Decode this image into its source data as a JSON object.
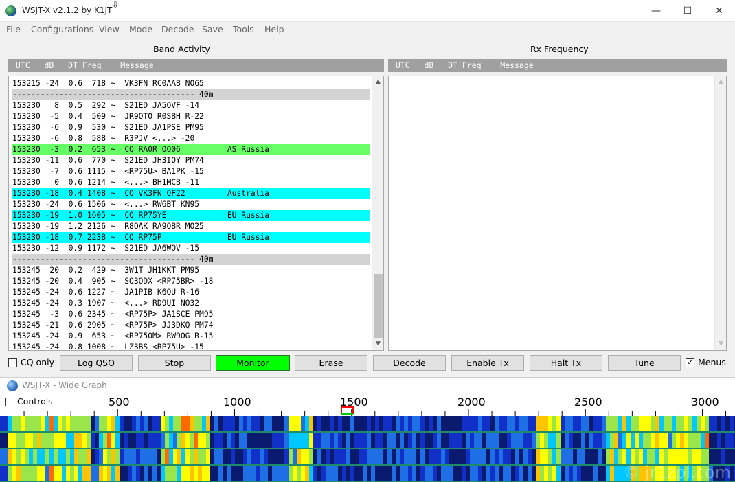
{
  "window": {
    "title": "WSJT-X   v2.1.2   by K1JT",
    "min_glyph": "—",
    "max_glyph": "☐",
    "close_glyph": "✕"
  },
  "menu": [
    "File",
    "Configurations",
    "View",
    "Mode",
    "Decode",
    "Save",
    "Tools",
    "Help"
  ],
  "band_activity": {
    "title": "Band Activity",
    "header": " UTC   dB   DT Freq    Message",
    "rows": [
      {
        "text": "153215 -24  0.6  718 ~  VK3FN RC0AAB NO65",
        "style": ""
      },
      {
        "text": "--------------------------------------- 40m",
        "style": "sep"
      },
      {
        "text": "153230   8  0.5  292 ~  S21ED JA5OVF -14",
        "style": ""
      },
      {
        "text": "153230  -5  0.4  509 ~  JR9OTO R0SBH R-22",
        "style": ""
      },
      {
        "text": "153230  -6  0.9  530 ~  S21ED JA1PSE PM95",
        "style": ""
      },
      {
        "text": "153230  -6  0.8  588 ~  R3PJV <...> -20",
        "style": ""
      },
      {
        "text": "153230  -3  0.2  653 ~  CQ RA0R OO06          AS Russia",
        "style": "green"
      },
      {
        "text": "153230 -11  0.6  770 ~  S21ED JH3IOY PM74",
        "style": ""
      },
      {
        "text": "153230  -7  0.6 1115 ~  <RP75U> BA1PK -15",
        "style": ""
      },
      {
        "text": "153230   0  0.6 1214 ~  <...> BH1MCB -11",
        "style": ""
      },
      {
        "text": "153230 -18  0.4 1408 ~  CQ VK3FN QF22         Australia",
        "style": "cyan"
      },
      {
        "text": "153230 -24  0.6 1506 ~  <...> RW6BT KN95",
        "style": ""
      },
      {
        "text": "153230 -19  1.0 1605 ~  CQ RP75YE             EU Russia",
        "style": "cyan"
      },
      {
        "text": "153230 -19  1.2 2126 ~  R8OAK RA9QBR MO25",
        "style": ""
      },
      {
        "text": "153230 -18  0.7 2238 ~  CQ RP75P              EU Russia",
        "style": "cyan"
      },
      {
        "text": "153230 -12  0.9 1172 ~  S21ED JA6WOV -15",
        "style": ""
      },
      {
        "text": "--------------------------------------- 40m",
        "style": "sep"
      },
      {
        "text": "153245  20  0.2  429 ~  3W1T JH1KKT PM95",
        "style": ""
      },
      {
        "text": "153245 -20  0.4  905 ~  SQ3ODX <RP75BR> -18",
        "style": ""
      },
      {
        "text": "153245 -24  0.6 1227 ~  JA1PIB K6QU R-16",
        "style": ""
      },
      {
        "text": "153245 -24  0.3 1907 ~  <...> RD9UI NO32",
        "style": ""
      },
      {
        "text": "153245  -3  0.6 2345 ~  <RP75P> JA1SCE PM95",
        "style": ""
      },
      {
        "text": "153245 -21  0.6 2905 ~  <RP75P> JJ3DKQ PM74",
        "style": ""
      },
      {
        "text": "153245 -24  0.9  653 ~  <RP75OM> RW9OG R-15",
        "style": ""
      },
      {
        "text": "153245 -24  0.8 1008 ~  LZ3BS <RP75U> -15",
        "style": ""
      }
    ]
  },
  "rx_frequency": {
    "title": "Rx Frequency",
    "header": " UTC   dB   DT Freq    Message"
  },
  "controls": {
    "cq_only": "CQ only",
    "log_qso": "Log QSO",
    "stop": "Stop",
    "monitor": "Monitor",
    "erase": "Erase",
    "decode": "Decode",
    "enable_tx": "Enable Tx",
    "halt_tx": "Halt Tx",
    "tune": "Tune",
    "menus": "Menus",
    "menus_checked": true,
    "cq_only_checked": false
  },
  "wide_graph": {
    "title": "WSJT-X - Wide Graph",
    "controls_label": "Controls",
    "ticks": [
      "500",
      "1000",
      "1500",
      "2000",
      "2500",
      "3000"
    ],
    "watermark": "© jr1zpl.com"
  },
  "colors": {
    "monitor_on": "#00ff00",
    "cq_highlight": "#66ff66",
    "new_dxcc_highlight": "#00ffff",
    "separator": "#d3d3d3",
    "header_gray": "#a0a0a0"
  }
}
